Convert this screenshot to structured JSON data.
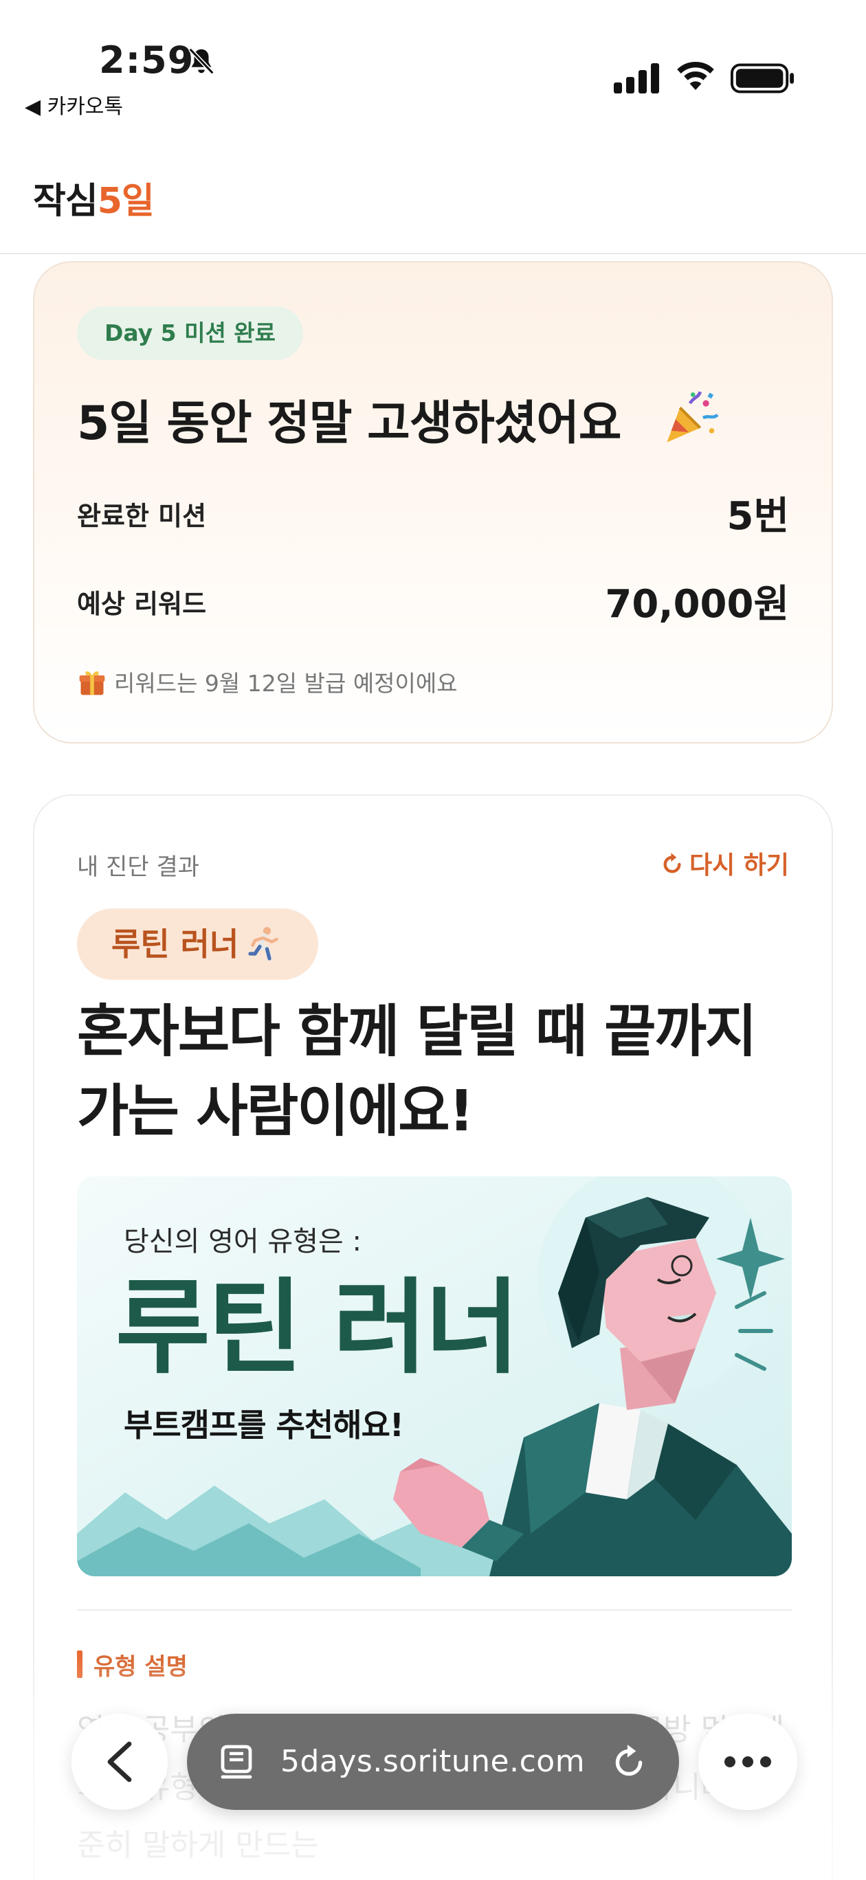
{
  "status_bar": {
    "time": "2:59",
    "back_app": "◀ 카카오톡"
  },
  "header": {
    "logo_main": "작심",
    "logo_accent": "5일",
    "accent_color": "#e8652c"
  },
  "completion_card": {
    "badge": "Day 5 미션 완료",
    "title": "5일 동안 정말 고생하셨어요",
    "title_icon": "party-popper-icon",
    "rows": [
      {
        "label": "완료한 미션",
        "value": "5번"
      },
      {
        "label": "예상 리워드",
        "value": "70,000원"
      }
    ],
    "note": "리워드는 9월 12일 발급 예정이에요",
    "note_icon": "gift-icon"
  },
  "result_card": {
    "label": "내 진단 결과",
    "retry": "다시 하기",
    "type_badge": "루틴 러너",
    "type_badge_icon": "runner-icon",
    "headline": "혼자보다 함께 달릴 때 끝까지 가는 사람이에요!",
    "banner": {
      "subtitle": "당신의 영어 유형은 :",
      "title": "루틴 러너",
      "cta": "부트캠프를 추천해요!"
    },
    "section_title": "유형 설명",
    "description": "영어 공부의 시작이 어렵지 않지만 혼자서는 금방 멈추게 되는 유형이에요. 입니다 열정이 부족한 것이 아니라 꾸준히 말하게 만드는"
  },
  "browser": {
    "url": "5days.soritune.com"
  }
}
